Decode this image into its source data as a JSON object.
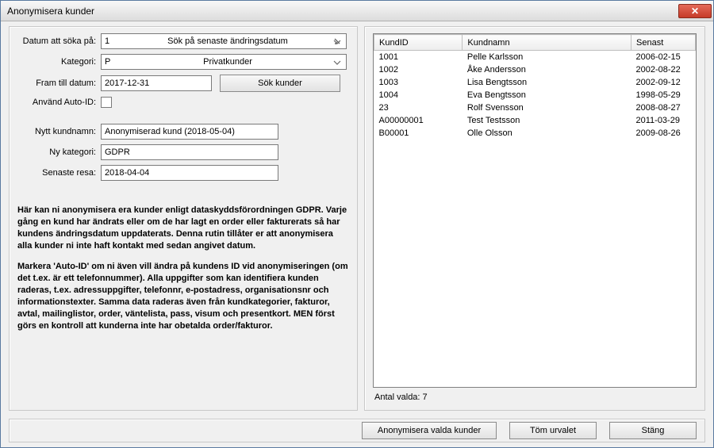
{
  "window": {
    "title": "Anonymisera kunder"
  },
  "labels": {
    "datum_att_soka": "Datum att söka på:",
    "kategori": "Kategori:",
    "fram_till_datum": "Fram till datum:",
    "anvand_auto_id": "Använd Auto-ID:",
    "nytt_kundnamn": "Nytt kundnamn:",
    "ny_kategori": "Ny kategori:",
    "senaste_resa": "Senaste resa:",
    "antal_valda": "Antal valda: 7"
  },
  "form": {
    "datum_code": "1",
    "datum_text": "Sök på senaste ändringsdatum",
    "kategori_code": "P",
    "kategori_text": "Privatkunder",
    "fram_till_datum": "2017-12-31",
    "nytt_kundnamn": "Anonymiserad kund (2018-05-04)",
    "ny_kategori": "GDPR",
    "senaste_resa": "2018-04-04"
  },
  "buttons": {
    "sok_kunder": "Sök kunder",
    "anonymisera": "Anonymisera valda kunder",
    "tom_urvalet": "Töm urvalet",
    "stang": "Stäng"
  },
  "description": {
    "p1": "Här kan ni anonymisera era kunder enligt dataskyddsförordningen GDPR. Varje gång en kund har ändrats eller om de har lagt en order eller fakturerats så har kundens ändringsdatum uppdaterats. Denna rutin tillåter er att anonymisera alla kunder ni inte haft kontakt med sedan angivet datum.",
    "p2": "Markera 'Auto-ID' om ni även vill ändra på kundens ID vid anonymiseringen (om det t.ex. är ett telefonnummer). Alla uppgifter som kan identifiera kunden raderas, t.ex. adressuppgifter, telefonnr, e-postadress, organisationsnr och informationstexter. Samma data raderas även från kundkategorier, fakturor, avtal, mailinglistor, order, väntelista, pass, visum och presentkort. MEN först görs en kontroll att kunderna inte har obetalda order/fakturor."
  },
  "table": {
    "headers": {
      "id": "KundID",
      "namn": "Kundnamn",
      "senast": "Senast"
    },
    "rows": [
      {
        "id": "1001",
        "namn": "Pelle Karlsson",
        "senast": "2006-02-15"
      },
      {
        "id": "1002",
        "namn": "Åke Andersson",
        "senast": "2002-08-22"
      },
      {
        "id": "1003",
        "namn": "Lisa Bengtsson",
        "senast": "2002-09-12"
      },
      {
        "id": "1004",
        "namn": "Eva Bengtsson",
        "senast": "1998-05-29"
      },
      {
        "id": "23",
        "namn": "Rolf Svensson",
        "senast": "2008-08-27"
      },
      {
        "id": "A00000001",
        "namn": "Test Testsson",
        "senast": "2011-03-29"
      },
      {
        "id": "B00001",
        "namn": "Olle Olsson",
        "senast": "2009-08-26"
      }
    ]
  }
}
